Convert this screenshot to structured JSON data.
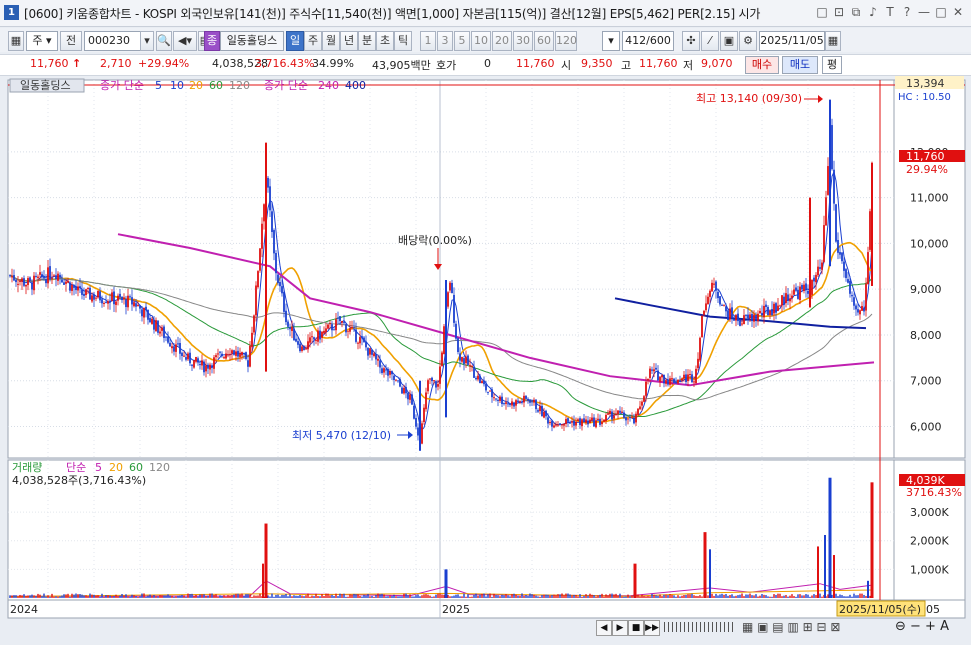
{
  "titlebar": {
    "window_number": "1",
    "title": "[0600] 키움종합차트 - KOSPI 외국인보유[141(천)] 주식수[11,540(천)] 액면[1,000] 자본금[115(억)] 결산[12월] EPS[5,462] PER[2.15] 시가",
    "icons": [
      "restore-icon",
      "window-icon",
      "tile-icon",
      "pin-icon",
      "text-icon",
      "help-icon",
      "minimize-icon",
      "maximize-icon",
      "close-icon"
    ],
    "icon_glyphs": [
      "□",
      "⊡",
      "⧉",
      "♪",
      "T",
      "?",
      "—",
      "□",
      "✕"
    ]
  },
  "toolbar": {
    "period_select": "주",
    "prev_label": "전",
    "stock_code": "000230",
    "stock_name_badge": "종",
    "stock_name": "일동홀딩스",
    "periods": [
      "일",
      "주",
      "월",
      "년",
      "분",
      "초",
      "틱"
    ],
    "active_period": "일",
    "intervals": [
      "1",
      "3",
      "5",
      "10",
      "20",
      "30",
      "60",
      "120"
    ],
    "count_display": "412/600",
    "date": "2025/11/05"
  },
  "price_row": {
    "price": "11,760",
    "change": "2,710",
    "change_pct": "+29.94%",
    "volume": "4,038,528",
    "volume_ratio": "3,716.43%",
    "turnover": "34.99%",
    "amount": "43,905백만",
    "hoga_label": "호가",
    "hoga_value": "0",
    "current": "11,760",
    "open_label": "시",
    "open": "9,350",
    "high_label": "고",
    "high": "11,760",
    "low_label": "저",
    "low": "9,070",
    "buy_label": "매수",
    "sell_label": "매도",
    "eval_label": "평"
  },
  "chart": {
    "legend_stock": "일동홀딩스",
    "legend_ma_label": "종가 단순",
    "legend_ma_periods": [
      "5",
      "10",
      "20",
      "60",
      "120"
    ],
    "legend_ma2_label": "종가 단순",
    "legend_ma2_periods": [
      "240",
      "400"
    ],
    "max_annotation": "최고 13,140 (09/30)",
    "min_annotation": "최저 5,470 (12/10)",
    "dividend_annotation": "배당락(0.00%)",
    "price_axis_ticks": [
      "12,000",
      "11,000",
      "10,000",
      "9,000",
      "8,000",
      "7,000",
      "6,000"
    ],
    "top_label": "13,394",
    "hc_label": "HC : 10.50",
    "current_price_label": "11,760",
    "current_pct_label": "29.94%",
    "volume_legend_label": "거래량",
    "volume_legend_ma_label": "단순",
    "volume_legend_periods": [
      "5",
      "20",
      "60",
      "120"
    ],
    "volume_value": "4,038,528주(3,716.43%)",
    "volume_axis_ticks": [
      "3,000K",
      "2,000K",
      "1,000K"
    ],
    "volume_current_label": "4,039K",
    "volume_pct_label": "3716.43%",
    "x_labels": [
      "2024",
      "2025"
    ],
    "date_badge": "2025/11/05(수)",
    "date_badge_suffix": "05",
    "colors": {
      "up": "#e01010",
      "down": "#1a3fd0",
      "ma5": "#1a3fd0",
      "ma10": "#1a3fd0",
      "ma20": "#f0a000",
      "ma60": "#2a9a3a",
      "ma120": "#888888",
      "ma240": "#c020b0",
      "ma400": "#1020a0"
    }
  },
  "chart_data": {
    "type": "candlestick",
    "x_range": [
      "2024-01",
      "2025-11-05"
    ],
    "ylim": [
      5400,
      13394
    ],
    "price_points": [
      [
        "2024-01",
        9300
      ],
      [
        "2024-02",
        8900
      ],
      [
        "2024-03",
        8700
      ],
      [
        "2024-04",
        7400
      ],
      [
        "2024-05",
        7700
      ],
      [
        "2024-06",
        11500
      ],
      [
        "2024-07",
        8100
      ],
      [
        "2024-08",
        8300
      ],
      [
        "2024-09",
        7500
      ],
      [
        "2024-10",
        6800
      ],
      [
        "2024-12-10",
        5470
      ],
      [
        "2025-01",
        8800
      ],
      [
        "2025-02",
        6700
      ],
      [
        "2025-03",
        6500
      ],
      [
        "2025-04",
        6100
      ],
      [
        "2025-05",
        6000
      ],
      [
        "2025-06",
        7000
      ],
      [
        "2025-07",
        9100
      ],
      [
        "2025-08",
        8200
      ],
      [
        "2025-09-30",
        13140
      ],
      [
        "2025-10",
        8400
      ],
      [
        "2025-11-05",
        11760
      ]
    ],
    "volume_spikes": [
      [
        "2024-06",
        2600
      ],
      [
        "2025-01",
        1000
      ],
      [
        "2025-06",
        1200
      ],
      [
        "2025-07",
        2300
      ],
      [
        "2025-09-30",
        4200
      ],
      [
        "2025-11-05",
        4039
      ]
    ]
  }
}
